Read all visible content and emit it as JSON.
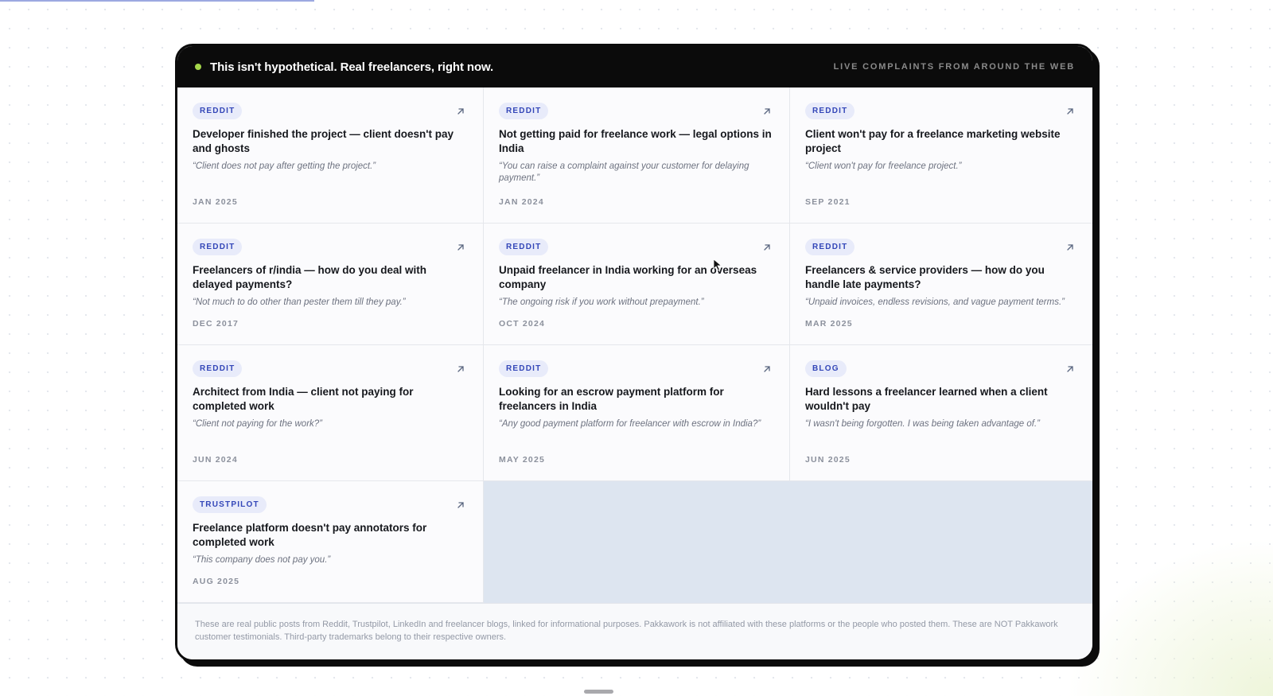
{
  "header": {
    "title": "This isn't hypothetical. Real freelancers, right now.",
    "subtitle": "LIVE COMPLAINTS FROM AROUND THE WEB",
    "live_dot_color": "#a4d64a"
  },
  "posts": [
    {
      "source": "REDDIT",
      "title": "Developer finished the project — client doesn't pay and ghosts",
      "quote": "“Client does not pay after getting the project.”",
      "date": "JAN 2025",
      "icon": "arrow-up-right-icon"
    },
    {
      "source": "REDDIT",
      "title": "Not getting paid for freelance work — legal options in India",
      "quote": "“You can raise a complaint against your customer for delaying payment.”",
      "date": "JAN 2024",
      "icon": "arrow-up-right-icon"
    },
    {
      "source": "REDDIT",
      "title": "Client won't pay for a freelance marketing website project",
      "quote": "“Client won't pay for freelance project.”",
      "date": "SEP 2021",
      "icon": "arrow-up-right-icon"
    },
    {
      "source": "REDDIT",
      "title": "Freelancers of r/india — how do you deal with delayed payments?",
      "quote": "“Not much to do other than pester them till they pay.”",
      "date": "DEC 2017",
      "icon": "arrow-up-right-icon"
    },
    {
      "source": "REDDIT",
      "title": "Unpaid freelancer in India working for an overseas company",
      "quote": "“The ongoing risk if you work without prepayment.”",
      "date": "OCT 2024",
      "icon": "arrow-up-right-icon"
    },
    {
      "source": "REDDIT",
      "title": "Freelancers & service providers — how do you handle late payments?",
      "quote": "“Unpaid invoices, endless revisions, and vague payment terms.”",
      "date": "MAR 2025",
      "icon": "arrow-up-right-icon"
    },
    {
      "source": "REDDIT",
      "title": "Architect from India — client not paying for completed work",
      "quote": "“Client not paying for the work?”",
      "date": "JUN 2024",
      "icon": "arrow-up-right-icon"
    },
    {
      "source": "REDDIT",
      "title": "Looking for an escrow payment platform for freelancers in India",
      "quote": "“Any good payment platform for freelancer with escrow in India?”",
      "date": "MAY 2025",
      "icon": "arrow-up-right-icon"
    },
    {
      "source": "BLOG",
      "title": "Hard lessons a freelancer learned when a client wouldn't pay",
      "quote": "“I wasn't being forgotten. I was being taken advantage of.”",
      "date": "JUN 2025",
      "icon": "arrow-up-right-icon"
    },
    {
      "source": "TRUSTPILOT",
      "title": "Freelance platform doesn't pay annotators for completed work",
      "quote": "“This company does not pay you.”",
      "date": "AUG 2025",
      "icon": "arrow-up-right-icon"
    }
  ],
  "disclaimer": "These are real public posts from Reddit, Trustpilot, LinkedIn and freelancer blogs, linked for informational purposes. Pakkawork is not affiliated with these platforms or the people who posted them. These are NOT Pakkawork customer testimonials. Third-party trademarks belong to their respective owners.",
  "colors": {
    "tag_background": "#e8ebfa",
    "tag_text": "#3346b8",
    "header_background": "#0b0b0b"
  }
}
